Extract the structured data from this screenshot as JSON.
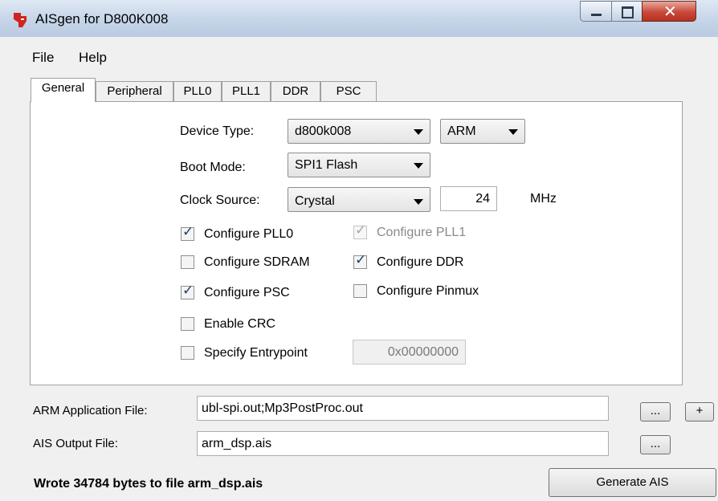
{
  "window": {
    "title": "AISgen for D800K008",
    "controls": {
      "minimize_icon": "minimize-icon",
      "maximize_icon": "maximize-icon",
      "close_icon": "close-icon"
    }
  },
  "menu": {
    "file": "File",
    "help": "Help"
  },
  "tabs": [
    "General",
    "Peripheral",
    "PLL0",
    "PLL1",
    "DDR",
    "PSC"
  ],
  "active_tab": "General",
  "general": {
    "device_type": {
      "label": "Device Type:",
      "value": "d800k008",
      "core": "ARM"
    },
    "boot_mode": {
      "label": "Boot Mode:",
      "value": "SPI1 Flash"
    },
    "clock_source": {
      "label": "Clock Source:",
      "value": "Crystal",
      "frequency": "24",
      "unit": "MHz"
    },
    "options": {
      "configure_pll0": {
        "label": "Configure PLL0",
        "checked": true,
        "enabled": true
      },
      "configure_pll1": {
        "label": "Configure PLL1",
        "checked": true,
        "enabled": false
      },
      "configure_sdram": {
        "label": "Configure SDRAM",
        "checked": false,
        "enabled": true
      },
      "configure_ddr": {
        "label": "Configure DDR",
        "checked": true,
        "enabled": true
      },
      "configure_psc": {
        "label": "Configure PSC",
        "checked": true,
        "enabled": true
      },
      "configure_pinmux": {
        "label": "Configure Pinmux",
        "checked": false,
        "enabled": true
      },
      "enable_crc": {
        "label": "Enable CRC",
        "checked": false,
        "enabled": true
      },
      "specify_entrypoint": {
        "label": "Specify Entrypoint",
        "checked": false,
        "enabled": true
      }
    },
    "entrypoint_value": "0x00000000"
  },
  "files": {
    "arm_app": {
      "label": "ARM Application File:",
      "value": "ubl-spi.out;Mp3PostProc.out",
      "browse": "...",
      "add": "+"
    },
    "ais_output": {
      "label": "AIS Output File:",
      "value": "arm_dsp.ais",
      "browse": "..."
    }
  },
  "status": "Wrote 34784 bytes to file arm_dsp.ais",
  "generate_button": "Generate AIS",
  "colors": {
    "check": "#1f3d70",
    "title_gradient_top": "#dfe9f5",
    "close_red": "#c8493a"
  }
}
